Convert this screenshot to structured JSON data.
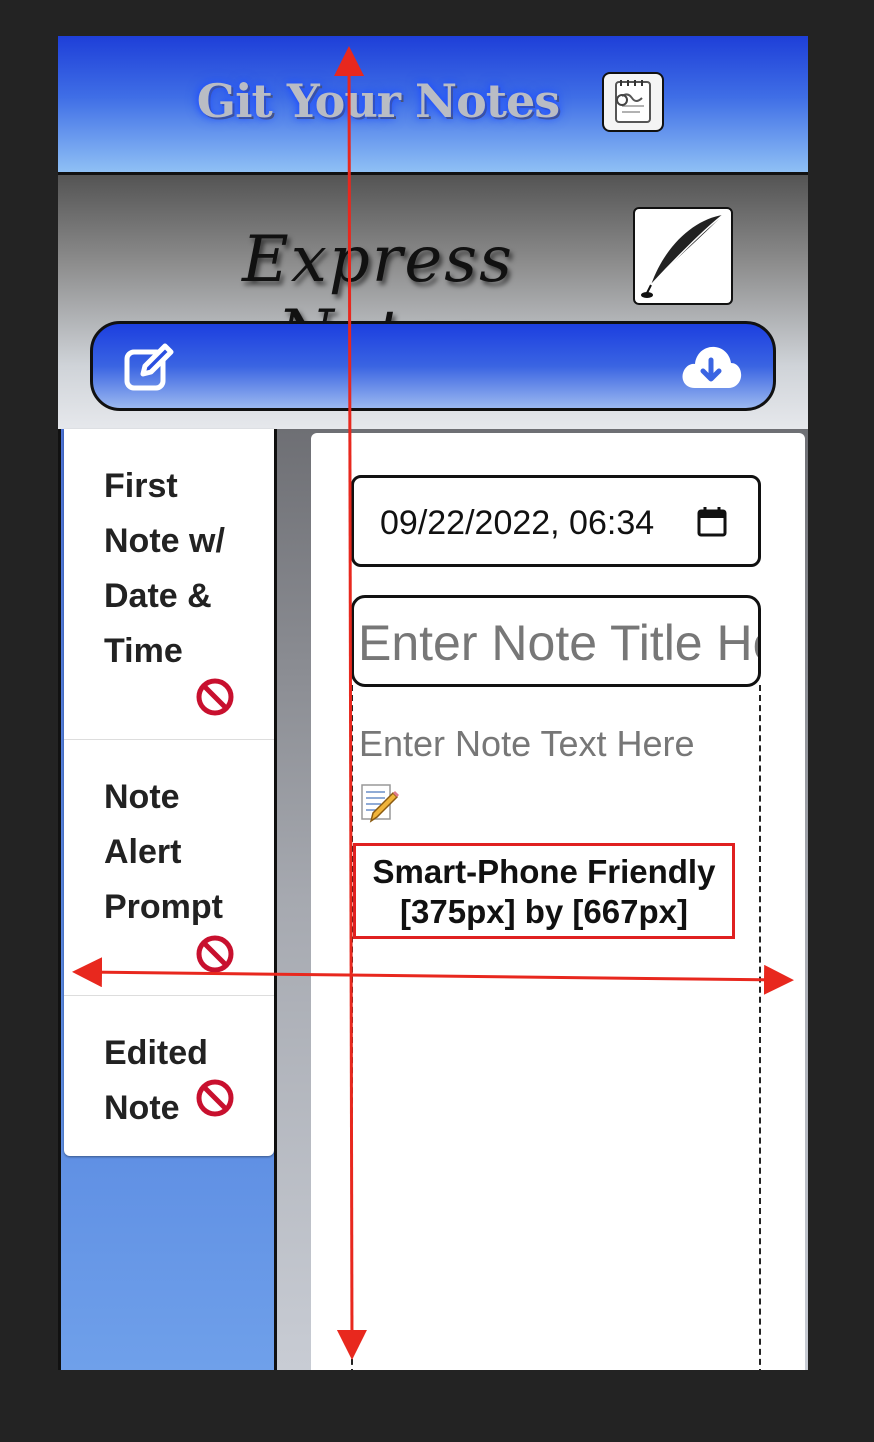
{
  "header": {
    "app_title": "Git Your Notes",
    "app_logo_icon": "notepad-logo-icon"
  },
  "express": {
    "title": "Express Notes",
    "feather_icon": "quill-feather-icon"
  },
  "action_bar": {
    "edit_icon": "pen-square-icon",
    "download_icon": "cloud-download-icon"
  },
  "notes": [
    {
      "title": "First Note w/ Date & Time",
      "delete_icon": "no-entry-icon"
    },
    {
      "title": "Note Alert Prompt",
      "delete_icon": "no-entry-icon"
    },
    {
      "title": "Edited Note",
      "delete_icon": "no-entry-icon"
    }
  ],
  "editor": {
    "date_value": "09/22/2022, 06:34",
    "title_placeholder": "Enter Note Title Here",
    "text_placeholder": "Enter Note Text Here"
  },
  "annotation": {
    "line1": "Smart-Phone Friendly",
    "line2": "[375px] by [667px]"
  },
  "colors": {
    "accent_blue": "#1e3fd8",
    "delete_red": "#c8102e",
    "annotation_red": "#e02020"
  }
}
